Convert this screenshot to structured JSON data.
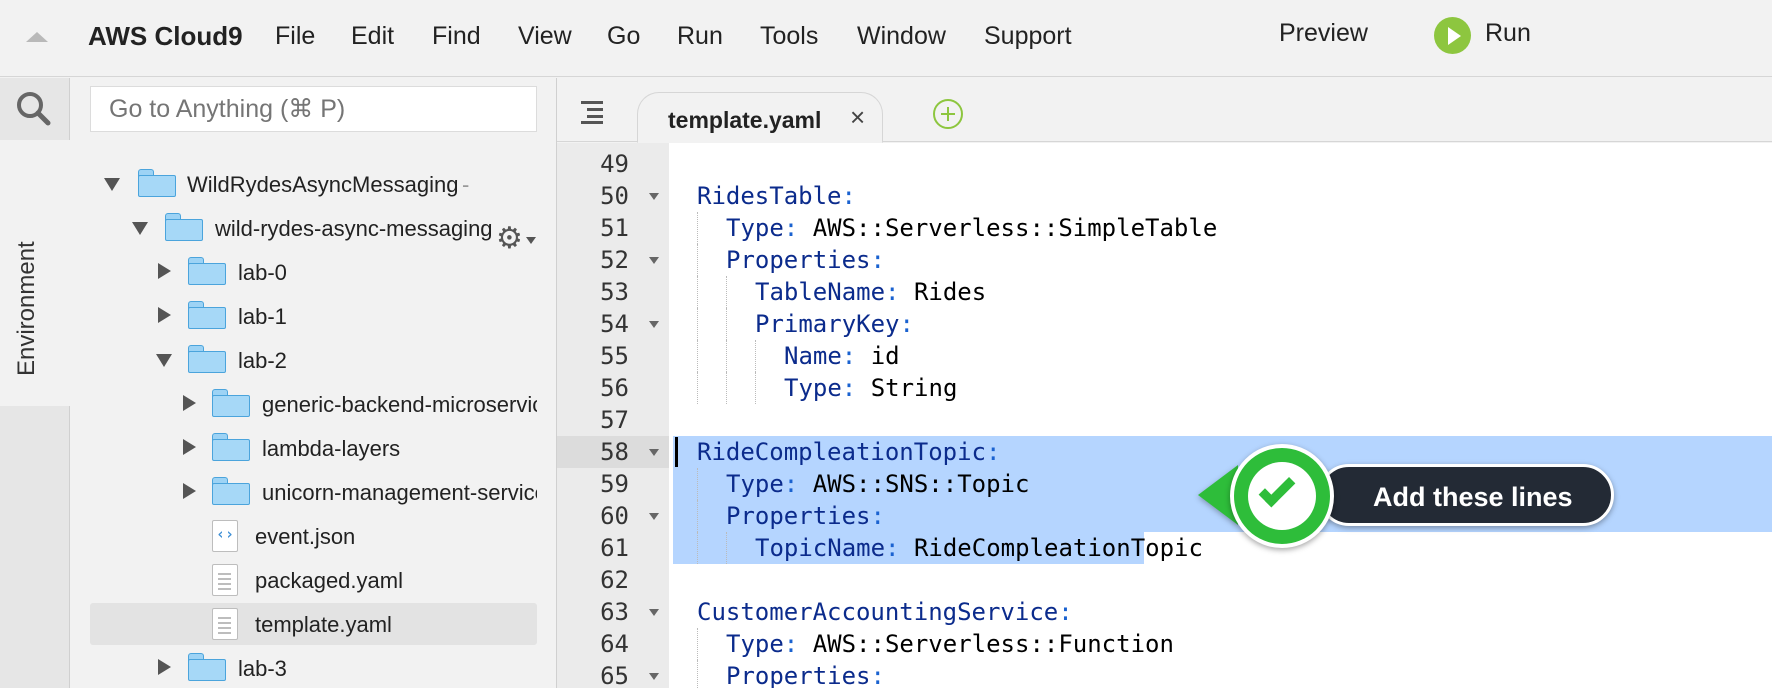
{
  "app": {
    "brand": "AWS Cloud9"
  },
  "menu": {
    "items": [
      "File",
      "Edit",
      "Find",
      "View",
      "Go",
      "Run",
      "Tools",
      "Window",
      "Support"
    ],
    "preview_label": "Preview",
    "run_label": "Run"
  },
  "rail": {
    "environment_label": "Environment"
  },
  "search": {
    "placeholder": "Go to Anything (⌘ P)"
  },
  "tree": {
    "items": [
      {
        "label": "WildRydesAsyncMessaging",
        "type": "folder",
        "expanded": true,
        "depth": 0
      },
      {
        "label": "wild-rydes-async-messaging",
        "type": "folder",
        "expanded": true,
        "depth": 1
      },
      {
        "label": "lab-0",
        "type": "folder",
        "expanded": false,
        "depth": 2
      },
      {
        "label": "lab-1",
        "type": "folder",
        "expanded": false,
        "depth": 2
      },
      {
        "label": "lab-2",
        "type": "folder",
        "expanded": true,
        "depth": 2
      },
      {
        "label": "generic-backend-microservice",
        "type": "folder",
        "expanded": false,
        "depth": 3
      },
      {
        "label": "lambda-layers",
        "type": "folder",
        "expanded": false,
        "depth": 3
      },
      {
        "label": "unicorn-management-service",
        "type": "folder",
        "expanded": false,
        "depth": 3
      },
      {
        "label": "event.json",
        "type": "json-file",
        "depth": 3
      },
      {
        "label": "packaged.yaml",
        "type": "file",
        "depth": 3
      },
      {
        "label": "template.yaml",
        "type": "file",
        "depth": 3,
        "selected": true
      },
      {
        "label": "lab-3",
        "type": "folder",
        "expanded": false,
        "depth": 2
      }
    ],
    "root_separator": "-"
  },
  "tabs": {
    "active": {
      "label": "template.yaml",
      "close": "×"
    }
  },
  "editor": {
    "lines": [
      {
        "n": "49",
        "key": "",
        "val": "",
        "fold": false
      },
      {
        "n": "50",
        "key": "RidesTable",
        "val": "",
        "fold": true
      },
      {
        "n": "51",
        "key": "Type",
        "val": "AWS::Serverless::SimpleTable",
        "fold": false
      },
      {
        "n": "52",
        "key": "Properties",
        "val": "",
        "fold": true
      },
      {
        "n": "53",
        "key": "TableName",
        "val": "Rides",
        "fold": false
      },
      {
        "n": "54",
        "key": "PrimaryKey",
        "val": "",
        "fold": true
      },
      {
        "n": "55",
        "key": "Name",
        "val": "id",
        "fold": false
      },
      {
        "n": "56",
        "key": "Type",
        "val": "String",
        "fold": false
      },
      {
        "n": "57",
        "key": "",
        "val": "",
        "fold": false
      },
      {
        "n": "58",
        "key": "RideCompleationTopic",
        "val": "",
        "fold": true,
        "highlight": true,
        "active": true
      },
      {
        "n": "59",
        "key": "Type",
        "val": "AWS::SNS::Topic",
        "fold": false,
        "highlight": true
      },
      {
        "n": "60",
        "key": "Properties",
        "val": "",
        "fold": true,
        "highlight": true
      },
      {
        "n": "61",
        "key": "TopicName",
        "val": "RideCompleationTopic",
        "fold": false,
        "highlight": true
      },
      {
        "n": "62",
        "key": "",
        "val": "",
        "fold": false
      },
      {
        "n": "63",
        "key": "CustomerAccountingService",
        "val": "",
        "fold": true
      },
      {
        "n": "64",
        "key": "Type",
        "val": "AWS::Serverless::Function",
        "fold": false
      },
      {
        "n": "65",
        "key": "Properties",
        "val": "",
        "fold": true
      }
    ],
    "colon": ":"
  },
  "callout": {
    "text": "Add these lines",
    "accent_color": "#2ebd3a"
  },
  "colors": {
    "run_green": "#8dc63f",
    "selection": "#b5d5ff",
    "yaml_key": "#0b2b8c"
  }
}
